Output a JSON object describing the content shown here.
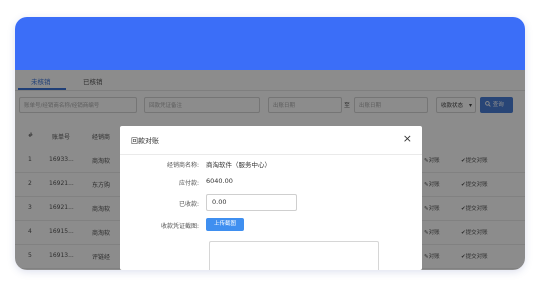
{
  "tabs": {
    "pending": "未核销",
    "done": "已核销"
  },
  "filters": {
    "order_search_placeholder": "账单号/经销商名称/经销商编号",
    "voucher_note_placeholder": "回款凭证备注",
    "start_date_placeholder": "出账日期",
    "range_separator": "至",
    "end_date_placeholder": "出账日期",
    "status_select": "收款状态",
    "search_button": "查询"
  },
  "table": {
    "headers": [
      "#",
      "账单号",
      "经销商"
    ],
    "rows": [
      {
        "index": "1",
        "bill_no": "16933...",
        "dealer": "商淘软",
        "reconcile": "对账",
        "submit": "提交对账"
      },
      {
        "index": "2",
        "bill_no": "16921...",
        "dealer": "东方购",
        "reconcile": "对账",
        "submit": "提交对账"
      },
      {
        "index": "3",
        "bill_no": "16921...",
        "dealer": "商淘软",
        "reconcile": "对账",
        "submit": "提交对账"
      },
      {
        "index": "4",
        "bill_no": "16915...",
        "dealer": "商淘软",
        "reconcile": "对账",
        "submit": "提交对账"
      },
      {
        "index": "5",
        "bill_no": "16913...",
        "dealer": "评链经",
        "reconcile": "对账",
        "submit": "提交对账"
      }
    ]
  },
  "modal": {
    "title": "回款对账",
    "close_glyph": "×",
    "dealer_label": "经销商名称:",
    "dealer_value": "商淘软件（服务中心）",
    "payable_label": "应付款:",
    "payable_value": "6040.00",
    "received_label": "已收款:",
    "received_value": "0.00",
    "voucher_label": "收款凭证截图:",
    "upload_button": "上传截图"
  },
  "colors": {
    "banner": "#3b6ef8",
    "accent": "#3b73d9",
    "upload_button": "#3f8ff0"
  },
  "icons": {
    "search": "search-icon",
    "edit": "edit-icon",
    "check": "check-circle-icon",
    "close": "close-icon",
    "dropdown": "chevron-down-icon"
  }
}
